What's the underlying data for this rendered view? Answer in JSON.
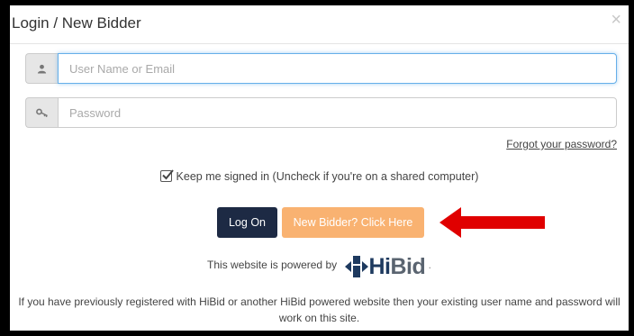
{
  "modal": {
    "title": "Login / New Bidder",
    "close_label": "×"
  },
  "form": {
    "username_placeholder": "User Name or Email",
    "password_placeholder": "Password",
    "forgot_label": "Forgot your password?",
    "keep_signed_in_label": "Keep me signed in (Uncheck if you're on a shared computer)",
    "keep_signed_in_checked": true
  },
  "buttons": {
    "logon_label": "Log On",
    "new_bidder_label": "New Bidder? Click Here"
  },
  "powered": {
    "text": "This website is powered by",
    "logo_hi": "Hi",
    "logo_bid": "Bid",
    "trailing": "."
  },
  "footer": {
    "text": "If you have previously registered with HiBid or another HiBid powered website then your existing user name and password will work on this site."
  },
  "colors": {
    "logon_bg": "#1d2a44",
    "new_bidder_bg": "#f9b271",
    "arrow": "#e00000",
    "focus_border": "#66afe9"
  },
  "icons": {
    "user": "user-icon",
    "password": "key-icon",
    "arrow": "arrow-left-icon",
    "logo": "hibid-logo-icon"
  }
}
